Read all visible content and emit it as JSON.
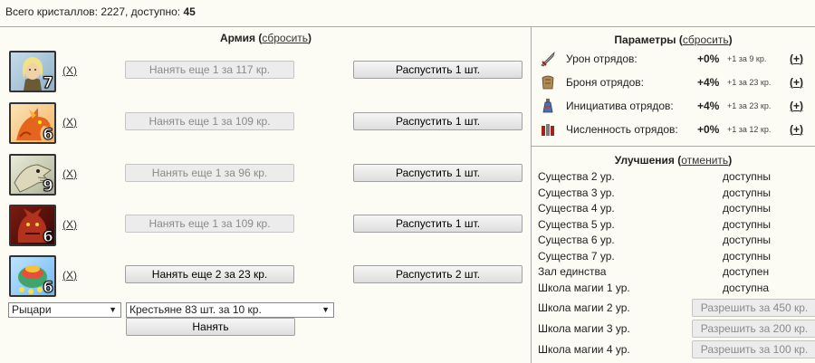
{
  "header": {
    "crystals_text": "Всего кристаллов: 2227, доступно: ",
    "available": "45"
  },
  "army": {
    "title": "Армия",
    "reset_label": "сбросить",
    "units": [
      {
        "level": "7",
        "remove": "X",
        "hire_label": "Нанять еще 1 за 117 кр.",
        "hire_enabled": false,
        "dismiss_label": "Распустить 1 шт.",
        "portrait": "elf-archer"
      },
      {
        "level": "6",
        "remove": "X",
        "hire_label": "Нанять еще 1 за 109 кр.",
        "hire_enabled": false,
        "dismiss_label": "Распустить 1 шт.",
        "portrait": "red-dragon"
      },
      {
        "level": "9",
        "remove": "X",
        "hire_label": "Нанять еще 1 за 96 кр.",
        "hire_enabled": false,
        "dismiss_label": "Распустить 1 шт.",
        "portrait": "bone-dragon"
      },
      {
        "level": "6",
        "remove": "X",
        "hire_label": "Нанять еще 1 за 109 кр.",
        "hire_enabled": false,
        "dismiss_label": "Распустить 1 шт.",
        "portrait": "red-demon"
      },
      {
        "level": "6",
        "remove": "X",
        "hire_label": "Нанять еще 2 за 23 кр.",
        "hire_enabled": true,
        "dismiss_label": "Распустить 2 шт.",
        "portrait": "mage-tower"
      }
    ],
    "faction_select": "Рыцари",
    "unit_select": "Крестьяне 83 шт. за 10 кр.",
    "hire_button": "Нанять"
  },
  "params": {
    "title": "Параметры",
    "reset_label": "сбросить",
    "items": [
      {
        "name": "Урон отрядов:",
        "value": "+0%",
        "cost": "+1 за 9 кр.",
        "plus": "+",
        "icon": "sword-icon"
      },
      {
        "name": "Броня отрядов:",
        "value": "+4%",
        "cost": "+1 за 23 кр.",
        "plus": "+",
        "icon": "armor-icon"
      },
      {
        "name": "Инициатива отрядов:",
        "value": "+4%",
        "cost": "+1 за 23 кр.",
        "plus": "+",
        "icon": "potion-icon"
      },
      {
        "name": "Численность отрядов:",
        "value": "+0%",
        "cost": "+1 за 12 кр.",
        "plus": "+",
        "icon": "troops-icon"
      }
    ]
  },
  "upgrades": {
    "title": "Улучшения",
    "cancel_label": "отменить",
    "items": [
      {
        "name": "Существа 2 ур.",
        "status": "доступны"
      },
      {
        "name": "Существа 3 ур.",
        "status": "доступны"
      },
      {
        "name": "Существа 4 ур.",
        "status": "доступны"
      },
      {
        "name": "Существа 5 ур.",
        "status": "доступны"
      },
      {
        "name": "Существа 6 ур.",
        "status": "доступны"
      },
      {
        "name": "Существа 7 ур.",
        "status": "доступны"
      },
      {
        "name": "Зал единства",
        "status": "доступен"
      },
      {
        "name": "Школа магии 1 ур.",
        "status": "доступна"
      },
      {
        "name": "Школа магии 2 ур.",
        "button": "Разрешить за 450 кр."
      },
      {
        "name": "Школа магии 3 ур.",
        "button": "Разрешить за 200 кр."
      },
      {
        "name": "Школа магии 4 ур.",
        "button": "Разрешить за 100 кр."
      }
    ]
  }
}
